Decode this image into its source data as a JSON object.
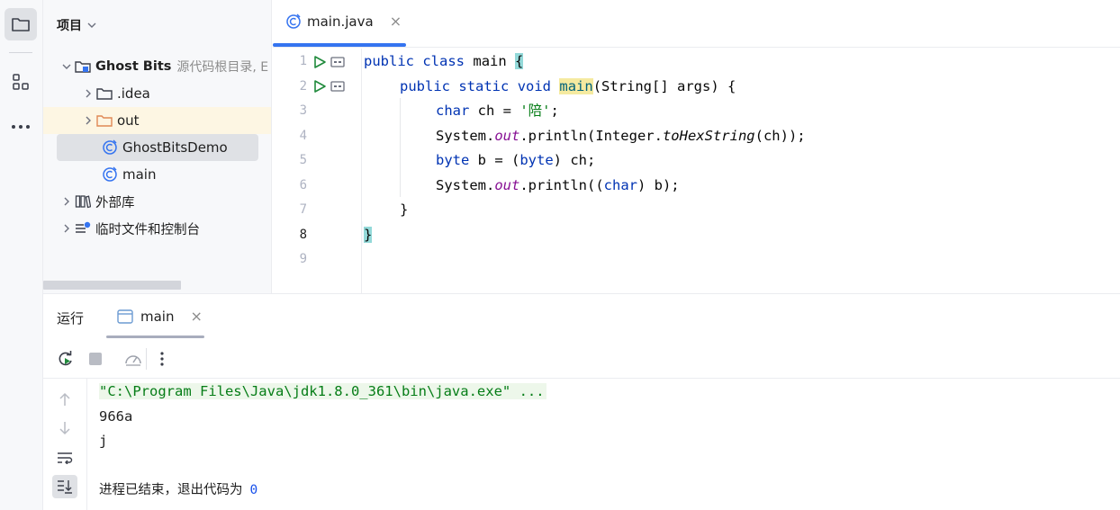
{
  "project_panel": {
    "title": "项目",
    "tree": [
      {
        "label": "Ghost Bits",
        "note": "源代码根目录, E",
        "expanded": true,
        "icon": "module-folder-icon"
      },
      {
        "label": ".idea",
        "icon": "folder-icon"
      },
      {
        "label": "out",
        "icon": "excluded-folder-icon"
      },
      {
        "label": "GhostBitsDemo",
        "icon": "java-class-icon"
      },
      {
        "label": "main",
        "icon": "java-class-icon"
      },
      {
        "label": "外部库",
        "icon": "library-icon"
      },
      {
        "label": "临时文件和控制台",
        "icon": "scratch-icon"
      }
    ]
  },
  "editor": {
    "tab": {
      "label": "main.java",
      "icon": "java-class-icon"
    },
    "line_numbers": [
      "1",
      "2",
      "3",
      "4",
      "5",
      "6",
      "7",
      "8",
      "9"
    ],
    "current_line": "8",
    "code": {
      "l1": {
        "kw1": "public",
        "kw2": "class",
        "name": "main",
        "brace": "{"
      },
      "l2": {
        "kw1": "public",
        "kw2": "static",
        "kw3": "void",
        "fn": "main",
        "rest": "(String[] args) {"
      },
      "l3": {
        "kw": "char",
        "mid": " ch = ",
        "str": "'陪'",
        "end": ";"
      },
      "l4": {
        "a": "System.",
        "field": "out",
        "b": ".println(Integer.",
        "method": "toHexString",
        "c": "(ch));"
      },
      "l5": {
        "kw1": "byte",
        "mid": " b = (",
        "kw2": "byte",
        "end": ") ch;"
      },
      "l6": {
        "a": "System.",
        "field": "out",
        "b": ".println((",
        "kw": "char",
        "c": ") b);"
      },
      "l7": {
        "text": "}"
      },
      "l8": {
        "text": "}"
      }
    }
  },
  "run_panel": {
    "title": "运行",
    "tab": {
      "label": "main",
      "icon": "run-config-icon"
    },
    "console_lines": [
      "\"C:\\Program Files\\Java\\jdk1.8.0_361\\bin\\java.exe\" ...",
      "966a",
      "j"
    ],
    "exit_message": "进程已结束，退出代码为",
    "exit_code": "0"
  }
}
